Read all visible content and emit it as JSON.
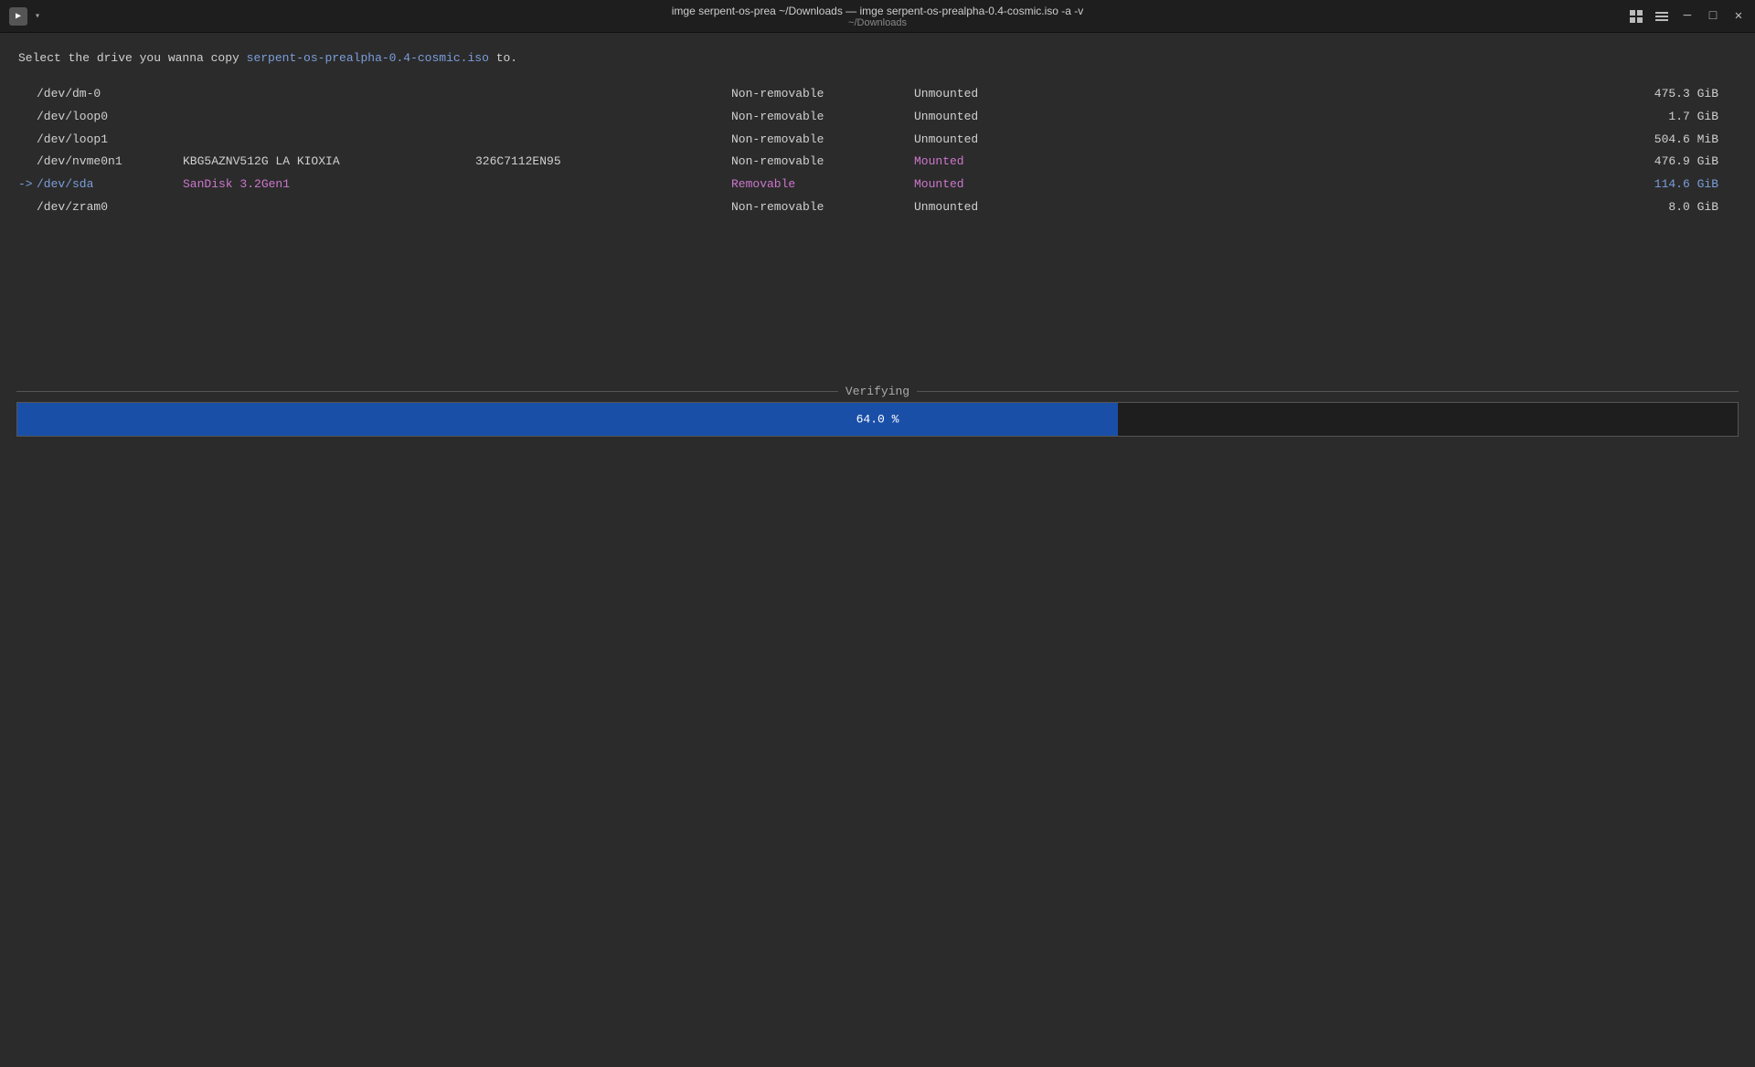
{
  "titlebar": {
    "title": "imge serpent-os-prea ~/Downloads — imge serpent-os-prealpha-0.4-cosmic.iso -a -v",
    "subtitle": "~/Downloads",
    "app_icon": "▶",
    "minimize_btn": "─",
    "restore_btn": "□",
    "close_btn": "✕",
    "menu_icon": "☰",
    "grid_icon": "⊞"
  },
  "prompt": {
    "prefix": "Select the drive you wanna copy ",
    "iso": "serpent-os-prealpha-0.4-cosmic.iso",
    "suffix": " to."
  },
  "drives": [
    {
      "arrow": "",
      "device": "/dev/dm-0",
      "model": "",
      "serial": "",
      "removable": "Non-removable",
      "mount": "Unmounted",
      "size": "475.3 GiB",
      "is_selected": false,
      "is_removable": false,
      "is_mounted": false
    },
    {
      "arrow": "",
      "device": "/dev/loop0",
      "model": "",
      "serial": "",
      "removable": "Non-removable",
      "mount": "Unmounted",
      "size": "1.7 GiB",
      "is_selected": false,
      "is_removable": false,
      "is_mounted": false
    },
    {
      "arrow": "",
      "device": "/dev/loop1",
      "model": "",
      "serial": "",
      "removable": "Non-removable",
      "mount": "Unmounted",
      "size": "504.6 MiB",
      "is_selected": false,
      "is_removable": false,
      "is_mounted": false
    },
    {
      "arrow": "",
      "device": "/dev/nvme0n1",
      "model": "KBG5AZNV512G LA KIOXIA",
      "serial": "326C7112EN95",
      "removable": "Non-removable",
      "mount": "Mounted",
      "size": "476.9 GiB",
      "is_selected": false,
      "is_removable": false,
      "is_mounted": true
    },
    {
      "arrow": "->",
      "device": "/dev/sda",
      "model": "SanDisk 3.2Gen1",
      "serial": "",
      "removable": "Removable",
      "mount": "Mounted",
      "size": "114.6 GiB",
      "is_selected": true,
      "is_removable": true,
      "is_mounted": true
    },
    {
      "arrow": "",
      "device": "/dev/zram0",
      "model": "",
      "serial": "",
      "removable": "Non-removable",
      "mount": "Unmounted",
      "size": "8.0 GiB",
      "is_selected": false,
      "is_removable": false,
      "is_mounted": false
    }
  ],
  "progress": {
    "label": "Verifying",
    "percent": "64.0 %",
    "fill_percent": 64
  },
  "colors": {
    "accent_blue": "#7b9edb",
    "accent_purple": "#cc77cc",
    "progress_blue": "#1a4fa8",
    "bg_dark": "#1e1e1e",
    "border_color": "#555"
  }
}
